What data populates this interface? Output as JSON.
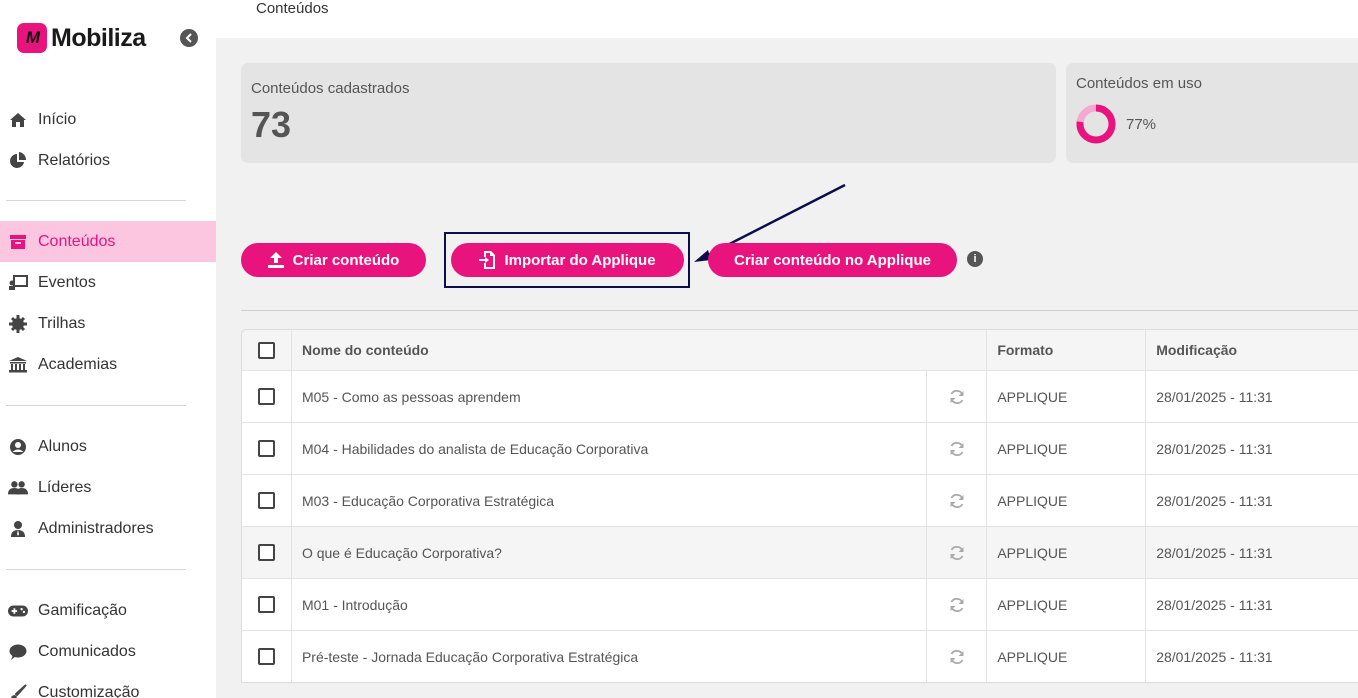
{
  "brand": {
    "name": "Mobiliza",
    "logo_mark": "M",
    "accent": "#e8137d"
  },
  "breadcrumb": "Conteúdos",
  "sidebar": {
    "collapse_icon": "chevron-left-icon",
    "items": [
      {
        "label": "Início",
        "icon": "home-icon"
      },
      {
        "label": "Relatórios",
        "icon": "pie-chart-icon"
      },
      {
        "label": "Conteúdos",
        "icon": "archive-icon",
        "active": true
      },
      {
        "label": "Eventos",
        "icon": "presentation-icon"
      },
      {
        "label": "Trilhas",
        "icon": "gear-badge-icon"
      },
      {
        "label": "Academias",
        "icon": "institution-icon"
      },
      {
        "label": "Alunos",
        "icon": "user-circle-icon"
      },
      {
        "label": "Líderes",
        "icon": "users-icon"
      },
      {
        "label": "Administradores",
        "icon": "user-tie-icon"
      },
      {
        "label": "Gamificação",
        "icon": "gamepad-icon"
      },
      {
        "label": "Comunicados",
        "icon": "chat-icon"
      },
      {
        "label": "Customização",
        "icon": "brush-icon"
      }
    ]
  },
  "stats": {
    "registered_label": "Conteúdos cadastrados",
    "registered_value": "73",
    "in_use_label": "Conteúdos em uso",
    "in_use_pct": "77%",
    "in_use_fraction": 0.77
  },
  "actions": {
    "create": "Criar conteúdo",
    "import": "Importar do Applique",
    "create_applique": "Criar conteúdo no Applique"
  },
  "table": {
    "headers": {
      "name": "Nome do conteúdo",
      "format": "Formato",
      "modified": "Modificação"
    },
    "rows": [
      {
        "name": "M05 - Como as pessoas aprendem",
        "format": "APPLIQUE",
        "modified": "28/01/2025 - 11:31"
      },
      {
        "name": "M04 - Habilidades do analista de Educação Corporativa",
        "format": "APPLIQUE",
        "modified": "28/01/2025 - 11:31"
      },
      {
        "name": "M03 - Educação Corporativa Estratégica",
        "format": "APPLIQUE",
        "modified": "28/01/2025 - 11:31"
      },
      {
        "name": "O que é Educação Corporativa?",
        "format": "APPLIQUE",
        "modified": "28/01/2025 - 11:31"
      },
      {
        "name": "M01 - Introdução",
        "format": "APPLIQUE",
        "modified": "28/01/2025 - 11:31"
      },
      {
        "name": "Pré-teste - Jornada Educação Corporativa Estratégica",
        "format": "APPLIQUE",
        "modified": "28/01/2025 - 11:31"
      }
    ]
  }
}
